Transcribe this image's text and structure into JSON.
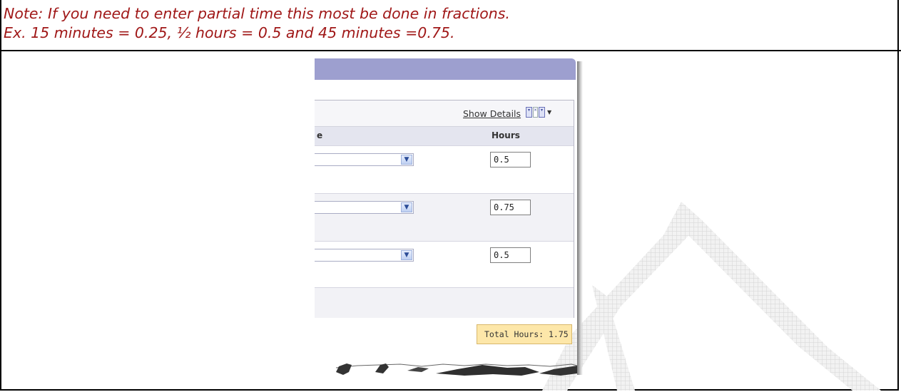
{
  "note": {
    "line1": "Note: If you need to enter partial time this most be done in fractions.",
    "line2": "Ex. 15 minutes = 0.25, ½ hours = 0.5 and 45 minutes =0.75."
  },
  "table": {
    "show_details": "Show Details",
    "column_chooser_icon": "column-chooser-icon",
    "col_left_fragment": "e",
    "col_hours": "Hours",
    "rows": [
      {
        "hours": "0.5"
      },
      {
        "hours": "0.75"
      },
      {
        "hours": "0.5"
      }
    ],
    "total_label": "Total Hours: 1.75"
  },
  "colors": {
    "note_text": "#a01818",
    "title_bar": "#9d9fcf",
    "header_bg": "#e4e5ef",
    "total_bg": "#fde7a9"
  }
}
